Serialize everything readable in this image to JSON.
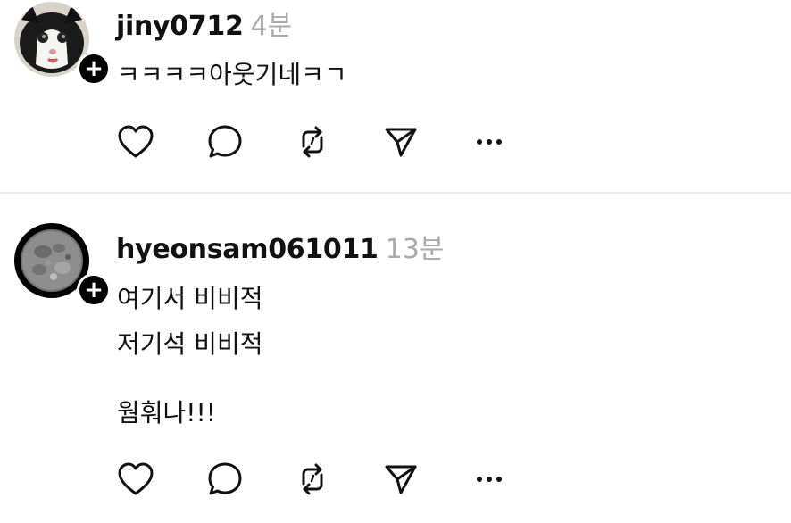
{
  "posts": [
    {
      "username": "jiny0712",
      "time": "4분",
      "lines": [
        "ㅋㅋㅋㅋ아웃기네ㅋㄱ"
      ],
      "avatar": "cat-avatar"
    },
    {
      "username": "hyeonsam061011",
      "time": "13분",
      "lines": [
        "여기서 비비적",
        "저기석 비비적",
        "웜훠나!!!"
      ],
      "avatar": "moon-avatar"
    }
  ],
  "badge_glyph": "+",
  "actions": {
    "like_icon": "heart-icon",
    "comment_icon": "comment-bubble-icon",
    "repost_icon": "repost-icon",
    "share_icon": "send-icon",
    "more_icon": "more-dots-icon"
  },
  "colors": {
    "text": "#111111",
    "muted": "#aaaaaa",
    "divider": "#ececec",
    "badge": "#000000"
  }
}
